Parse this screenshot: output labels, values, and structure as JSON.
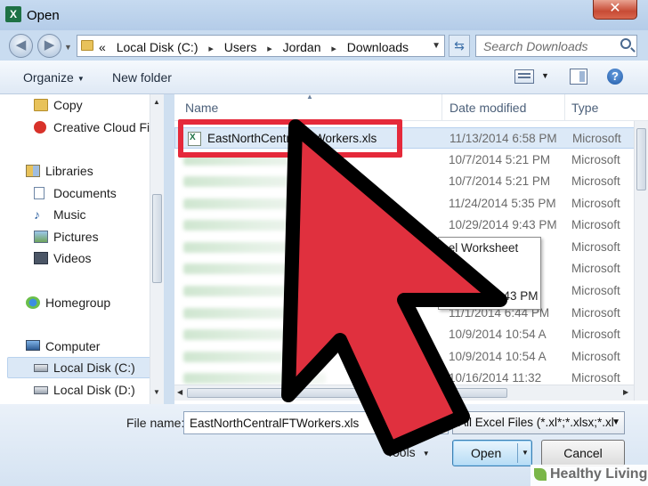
{
  "window": {
    "title": "Open",
    "app_icon": "excel-icon",
    "close_label": "✕"
  },
  "address": {
    "overflow": "«",
    "breadcrumbs": [
      "Local Disk (C:)",
      "Users",
      "Jordan",
      "Downloads"
    ],
    "separator": "▸"
  },
  "search": {
    "placeholder": "Search Downloads"
  },
  "toolbar": {
    "organize_label": "Organize",
    "new_folder_label": "New folder",
    "help_label": "?"
  },
  "nav": {
    "items": [
      {
        "label": "Copy",
        "icon": "folder-icon"
      },
      {
        "label": "Creative Cloud Fil",
        "icon": "creative-cloud-icon"
      },
      {
        "label": "Libraries",
        "icon": "libraries-icon"
      },
      {
        "label": "Documents",
        "icon": "documents-icon"
      },
      {
        "label": "Music",
        "icon": "music-icon"
      },
      {
        "label": "Pictures",
        "icon": "pictures-icon"
      },
      {
        "label": "Videos",
        "icon": "videos-icon"
      },
      {
        "label": "Homegroup",
        "icon": "homegroup-icon"
      },
      {
        "label": "Computer",
        "icon": "computer-icon"
      },
      {
        "label": "Local Disk (C:)",
        "icon": "disk-icon"
      },
      {
        "label": "Local Disk (D:)",
        "icon": "disk-icon"
      }
    ]
  },
  "files": {
    "columns": {
      "name": "Name",
      "date": "Date modified",
      "type": "Type"
    },
    "rows": [
      {
        "name": "EastNorthCentralFTWorkers.xls",
        "date": "11/13/2014 6:58 PM",
        "type": "Microsoft"
      },
      {
        "name": "",
        "date": "10/7/2014 5:21 PM",
        "type": "Microsoft"
      },
      {
        "name": "",
        "date": "10/7/2014 5:21 PM",
        "type": "Microsoft"
      },
      {
        "name": "",
        "date": "11/24/2014 5:35 PM",
        "type": "Microsoft"
      },
      {
        "name": "",
        "date": "10/29/2014 9:43 PM",
        "type": "Microsoft"
      },
      {
        "name": "",
        "date": "",
        "type": "Microsoft"
      },
      {
        "name": "",
        "date": "",
        "type": "Microsoft"
      },
      {
        "name": "",
        "date": "",
        "type": "Microsoft"
      },
      {
        "name": "",
        "date": "11/1/2014 6:44 PM",
        "type": "Microsoft"
      },
      {
        "name": "",
        "date": "10/9/2014 10:54 A",
        "type": "Microsoft"
      },
      {
        "name": "",
        "date": "10/9/2014 10:54 A",
        "type": "Microsoft"
      },
      {
        "name": "",
        "date": "10/16/2014 11:32",
        "type": "Microsoft"
      }
    ],
    "tooltip": {
      "line1": "cel Worksheet",
      "line2": "4 9:43 PM"
    }
  },
  "bottom": {
    "file_name_label": "File name:",
    "file_name_value": "EastNorthCentralFTWorkers.xls",
    "filter_label": "All Excel Files (*.xl*;*.xlsx;*.xl",
    "tools_label": "Tools",
    "open_label": "Open",
    "cancel_label": "Cancel"
  },
  "watermark": {
    "text": "Healthy Living"
  },
  "colors": {
    "highlight": "#e5293a",
    "arrow": "#e0303e",
    "selection": "#dce9f7"
  }
}
